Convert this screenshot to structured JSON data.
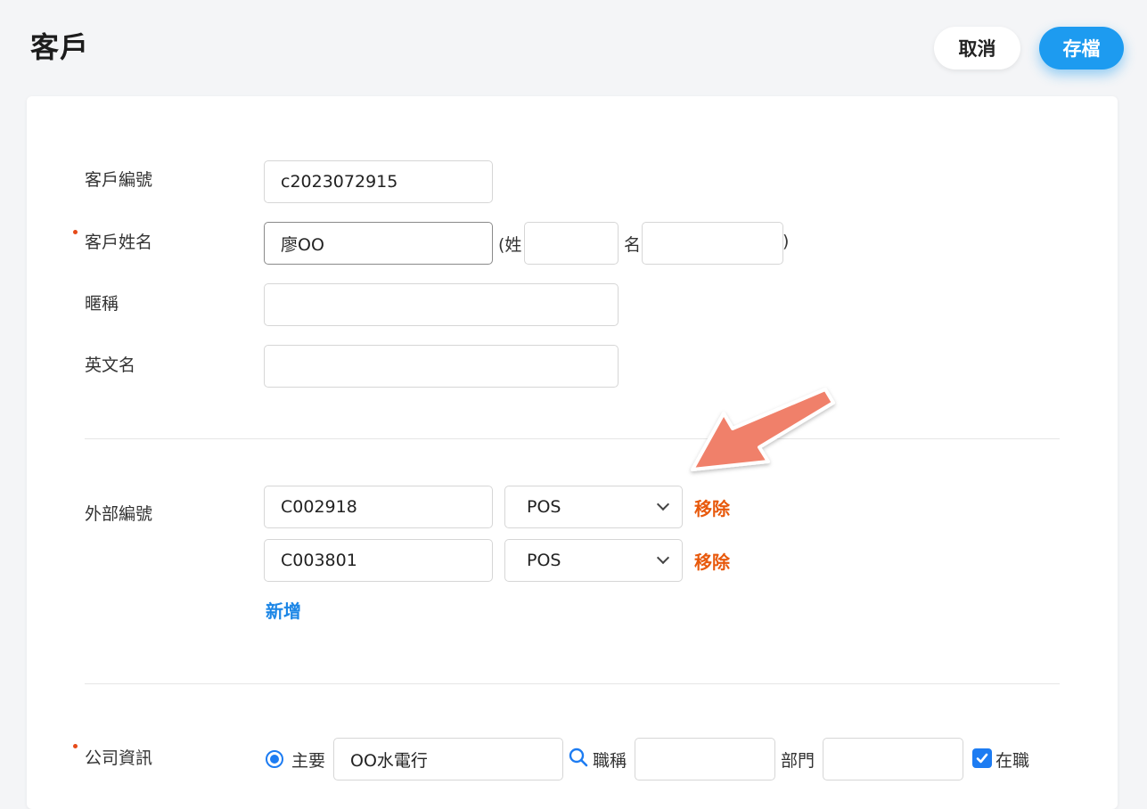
{
  "header": {
    "title": "客戶",
    "cancel_label": "取消",
    "save_label": "存檔"
  },
  "basic": {
    "customer_no_label": "客戶編號",
    "customer_no_value": "c2023072915",
    "name_label": "客戶姓名",
    "name_value": "廖OO",
    "surname_prefix": "(姓",
    "given_label": "名",
    "close_paren": ")",
    "surname_value": "",
    "given_value": "",
    "nickname_label": "暱稱",
    "nickname_value": "",
    "english_name_label": "英文名",
    "english_name_value": ""
  },
  "external": {
    "label": "外部編號",
    "rows": [
      {
        "code": "C002918",
        "source": "POS",
        "remove_label": "移除"
      },
      {
        "code": "C003801",
        "source": "POS",
        "remove_label": "移除"
      }
    ],
    "add_label": "新增"
  },
  "company": {
    "label": "公司資訊",
    "primary_label": "主要",
    "company_value": "OO水電行",
    "job_title_label": "職稱",
    "job_title_value": "",
    "department_label": "部門",
    "department_value": "",
    "employed_label": "在職",
    "employed_checked": true
  },
  "colors": {
    "accent": "#1d9bf0",
    "remove": "#e8590c",
    "link": "#1c86e6",
    "required_dot": "#e64a19",
    "annotation_arrow": "#f0806a"
  },
  "icons": {
    "search": "search-icon",
    "chevron": "chevron-down-icon",
    "annotation": "annotation-arrow-icon"
  }
}
